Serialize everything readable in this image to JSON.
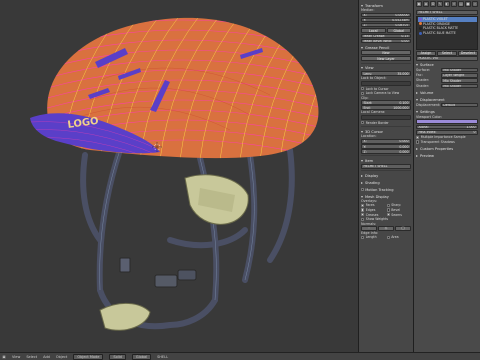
{
  "viewport": {
    "logo_text": "LOGO",
    "colors": {
      "background": "#393939",
      "shell": "#d9713f",
      "brim": "#5a3fc8",
      "wire": "#ff3db0",
      "wire2": "#ffe04a",
      "strap": "#4a4f64",
      "pad": "#c8c89a"
    }
  },
  "statusbar": {
    "mode_label": "Object Mode",
    "items": [
      "View",
      "Select",
      "Add",
      "Object"
    ],
    "shading_label": "Solid",
    "pivot_label": "Global",
    "object_name": "SHELL"
  },
  "npanel": {
    "transform_header": "Transform",
    "median_label": "Median:",
    "median": [
      {
        "axis": "X:",
        "value": "0.00000"
      },
      {
        "axis": "Y:",
        "value": "0.05234m"
      },
      {
        "axis": "Z:",
        "value": "0.08707"
      }
    ],
    "local_label": "Local",
    "global_label": "Global",
    "mean_crease_label": "Mean Crease:",
    "mean_crease": "0.15",
    "mean_bevel_label": "Mean Bevel Weig:",
    "mean_bevel": "0.00",
    "grease_header": "Grease Pencil",
    "new_label": "New",
    "new_layer_label": "New Layer",
    "view_header": "View",
    "lens_label": "Lens:",
    "lens_value": "35.000",
    "lock_to_object": "Lock to Object:",
    "lock_cursor": "Lock to Cursor",
    "lock_camera": "Lock Camera to View",
    "clip_label": "Clip:",
    "clip_start_label": "Start:",
    "clip_start": "0.100",
    "clip_end_label": "End:",
    "clip_end": "1000.000",
    "local_camera": "Local Camera:",
    "render_border": "Render Border",
    "cursor_header": "3D Cursor",
    "location_label": "Location:",
    "cursor": [
      {
        "axis": "X:",
        "value": "0.000"
      },
      {
        "axis": "Y:",
        "value": "0.000"
      },
      {
        "axis": "Z:",
        "value": "0.000"
      }
    ],
    "item_header": "Item",
    "item_name": "HELMET SHELL",
    "display_header": "Display",
    "shading_header": "Shading",
    "motion_tracking": "Motion Tracking",
    "mesh_display_header": "Mesh Display",
    "overlays_label": "Overlays:",
    "overlays": [
      [
        "Faces",
        "Sharp"
      ],
      [
        "Edges",
        "Bevel"
      ],
      [
        "Creases",
        "Seams"
      ]
    ],
    "show_weights": "Show Weights",
    "normals_label": "Normals:",
    "edge_info_label": "Edge Info:",
    "length": "Length",
    "area": "Area"
  },
  "props": {
    "tabs": [
      "▣",
      "◈",
      "⚙",
      "✎",
      "◐",
      "☼",
      "▤",
      "●",
      "◇"
    ],
    "object_name": "HELMET SHELL",
    "materials": [
      {
        "name": "PLASTIC VIOLET",
        "color": "#7a5bd8",
        "selected": true
      },
      {
        "name": "PLASTIC ORANGE",
        "color": "#e07a3a",
        "selected": false
      },
      {
        "name": "PLASTIC BLACK MATTE",
        "color": "#222222",
        "selected": false
      },
      {
        "name": "PLASTIC BLUE MATTE",
        "color": "#3b5fb8",
        "selected": false
      }
    ],
    "assign": "Assign",
    "select": "Select",
    "deselect": "Deselect",
    "material_field": "PLASTIC VIO",
    "surface_header": "Surface",
    "surface_label": "Surface:",
    "surface_value": "Mix Shader",
    "fac_label": "Fac:",
    "fac_value": "Layer Weight",
    "shader1_label": "Shader:",
    "shader1_value": "Mix Shader",
    "shader2_label": "Shader:",
    "shader2_value": "Mix Shader",
    "volume_header": "Volume",
    "displacement_header": "Displacement",
    "displacement_label": "Displacement:",
    "displacement_value": "Default",
    "settings_header": "Settings",
    "viewport_color": "Viewport Color:",
    "alpha_label": "Alpha:",
    "alpha_value": "1.000",
    "pass_label": "Pass Index:",
    "pass_value": "0",
    "multiple_importance": "Multiple Importance Sample",
    "transparent_shadows": "Transparent Shadows",
    "custom_properties": "Custom Properties",
    "preview": "Preview"
  }
}
